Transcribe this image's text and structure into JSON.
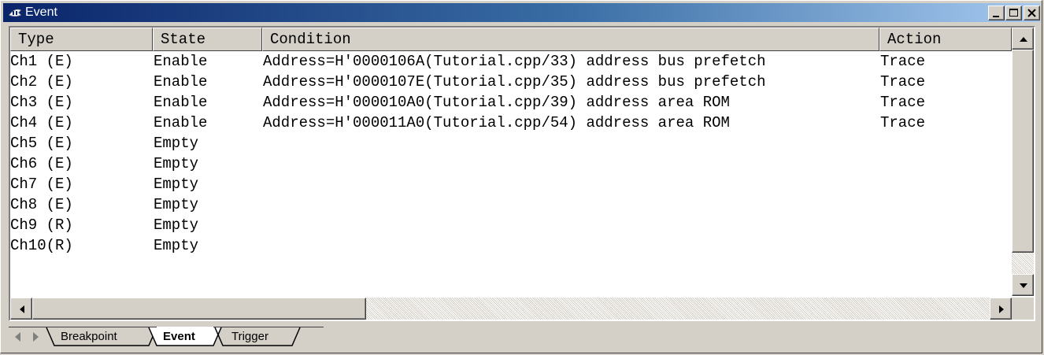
{
  "window": {
    "title": "Event",
    "icon": "event-window-icon"
  },
  "titlebar_buttons": [
    "minimize",
    "maximize",
    "close"
  ],
  "columns": [
    {
      "label": "Type"
    },
    {
      "label": "State"
    },
    {
      "label": "Condition"
    },
    {
      "label": "Action"
    }
  ],
  "rows": [
    {
      "type": "Ch1 (E)",
      "state": "Enable",
      "condition": "Address=H'0000106A(Tutorial.cpp/33) address bus prefetch",
      "action": "Trace"
    },
    {
      "type": "Ch2 (E)",
      "state": "Enable",
      "condition": "Address=H'0000107E(Tutorial.cpp/35) address bus prefetch",
      "action": "Trace"
    },
    {
      "type": "Ch3 (E)",
      "state": "Enable",
      "condition": "Address=H'000010A0(Tutorial.cpp/39) address area ROM",
      "action": "Trace"
    },
    {
      "type": "Ch4 (E)",
      "state": "Enable",
      "condition": "Address=H'000011A0(Tutorial.cpp/54) address area ROM",
      "action": "Trace"
    },
    {
      "type": "Ch5 (E)",
      "state": "Empty",
      "condition": "",
      "action": ""
    },
    {
      "type": "Ch6 (E)",
      "state": "Empty",
      "condition": "",
      "action": ""
    },
    {
      "type": "Ch7 (E)",
      "state": "Empty",
      "condition": "",
      "action": ""
    },
    {
      "type": "Ch8 (E)",
      "state": "Empty",
      "condition": "",
      "action": ""
    },
    {
      "type": "Ch9 (R)",
      "state": "Empty",
      "condition": "",
      "action": ""
    },
    {
      "type": "Ch10(R)",
      "state": "Empty",
      "condition": "",
      "action": ""
    }
  ],
  "tabs": [
    {
      "label": "Breakpoint",
      "active": false
    },
    {
      "label": "Event",
      "active": true
    },
    {
      "label": "Trigger",
      "active": false
    }
  ],
  "colors": {
    "title_start": "#0a246a",
    "title_end": "#a6caf0",
    "face": "#d4d0c8"
  }
}
